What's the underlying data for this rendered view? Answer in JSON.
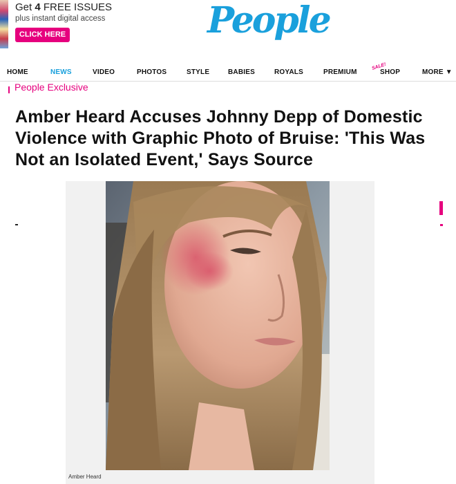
{
  "promo": {
    "line1_prefix": "Get ",
    "line1_bold": "4",
    "line1_suffix": " FREE ISSUES",
    "line2": "plus instant digital access",
    "cta": "CLICK HERE"
  },
  "logo": {
    "text": "People"
  },
  "nav": {
    "items": [
      {
        "label": "HOME"
      },
      {
        "label": "NEWS",
        "active": true
      },
      {
        "label": "VIDEO"
      },
      {
        "label": "PHOTOS"
      },
      {
        "label": "STYLE"
      },
      {
        "label": "BABIES"
      },
      {
        "label": "ROYALS"
      },
      {
        "label": "PREMIUM"
      },
      {
        "label": "SHOP"
      },
      {
        "label": "MORE ▼"
      }
    ],
    "sale_badge": "SALE!"
  },
  "article": {
    "kicker": "People Exclusive",
    "headline": "Amber Heard Accuses Johnny Depp of Domestic Violence with Graphic Photo of Bruise: 'This Was Not an Isolated Event,' Says Source",
    "image_caption": "Amber Heard"
  },
  "colors": {
    "brand_blue": "#1aa0dc",
    "accent_pink": "#e6007e"
  }
}
